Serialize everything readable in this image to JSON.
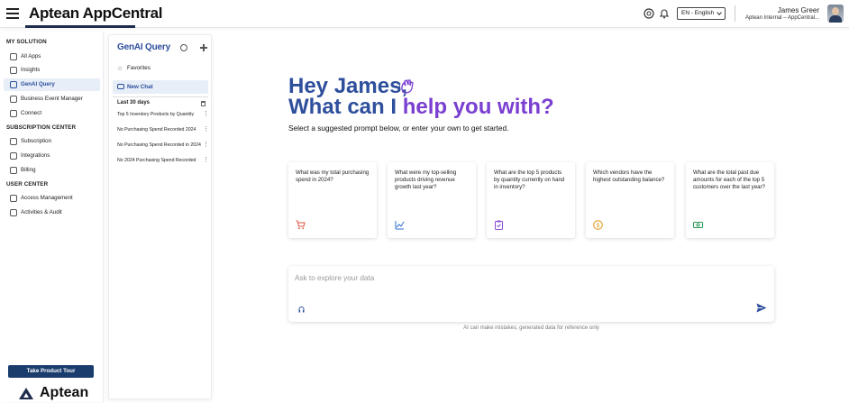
{
  "header": {
    "brand": "Aptean AppCentral",
    "language": "EN - English",
    "user_name": "James Greer",
    "user_org": "Aptean Internal – AppCentral..."
  },
  "nav": {
    "my_solution": "MY SOLUTION",
    "items_solution": [
      {
        "label": "All Apps",
        "icon": "grid-icon"
      },
      {
        "label": "Insights",
        "icon": "chart-icon"
      },
      {
        "label": "GenAI Query",
        "icon": "sparkle-icon",
        "active": true
      },
      {
        "label": "Business Event Manager",
        "icon": "calendar-icon"
      },
      {
        "label": "Connect",
        "icon": "link-icon"
      }
    ],
    "subscription_center": "SUBSCRIPTION CENTER",
    "items_subscription": [
      {
        "label": "Subscription",
        "icon": "tag-icon"
      },
      {
        "label": "Integrations",
        "icon": "plug-icon"
      },
      {
        "label": "Billing",
        "icon": "card-icon"
      }
    ],
    "user_center": "USER CENTER",
    "items_user": [
      {
        "label": "Access Management",
        "icon": "people-icon"
      },
      {
        "label": "Activities & Audit",
        "icon": "audit-icon"
      }
    ],
    "tour_button": "Take Product Tour",
    "footer_logo": "Aptean"
  },
  "history": {
    "title": "GenAI Query",
    "favorites": "Favorites",
    "new_chat": "New Chat",
    "period": "Last 30 days",
    "items": [
      "Top 5 Inventory Products by Quantity",
      "No Purchasing Spend Recorded 2024",
      "No Purchasing Spend Recorded in 2024",
      "No 2024 Purchasing Spend Recorded"
    ]
  },
  "main": {
    "greeting": "Hey James,",
    "question_part1": "What can I ",
    "question_part2": "help you with?",
    "subtitle": "Select a suggested prompt below, or enter your own to get started.",
    "cards": [
      {
        "text": "What was my total purchasing spend in 2024?",
        "icon": "cart-icon",
        "color": "#e0533d"
      },
      {
        "text": "What were my top-selling products driving revenue growth last year?",
        "icon": "trend-icon",
        "color": "#2f6fd0"
      },
      {
        "text": "What are the top 5 products by quantity currently on hand in inventory?",
        "icon": "clipboard-icon",
        "color": "#8a4fd6"
      },
      {
        "text": "Which vendors have the highest outstanding balance?",
        "icon": "coin-icon",
        "color": "#e39a1c"
      },
      {
        "text": "What are the total past due amounts for each of the top 5 customers over the last year?",
        "icon": "cash-icon",
        "color": "#2a9a5a"
      }
    ],
    "prompt_placeholder": "Ask to explore your data",
    "disclaimer": "AI can make mistakes, generated data for reference only"
  }
}
